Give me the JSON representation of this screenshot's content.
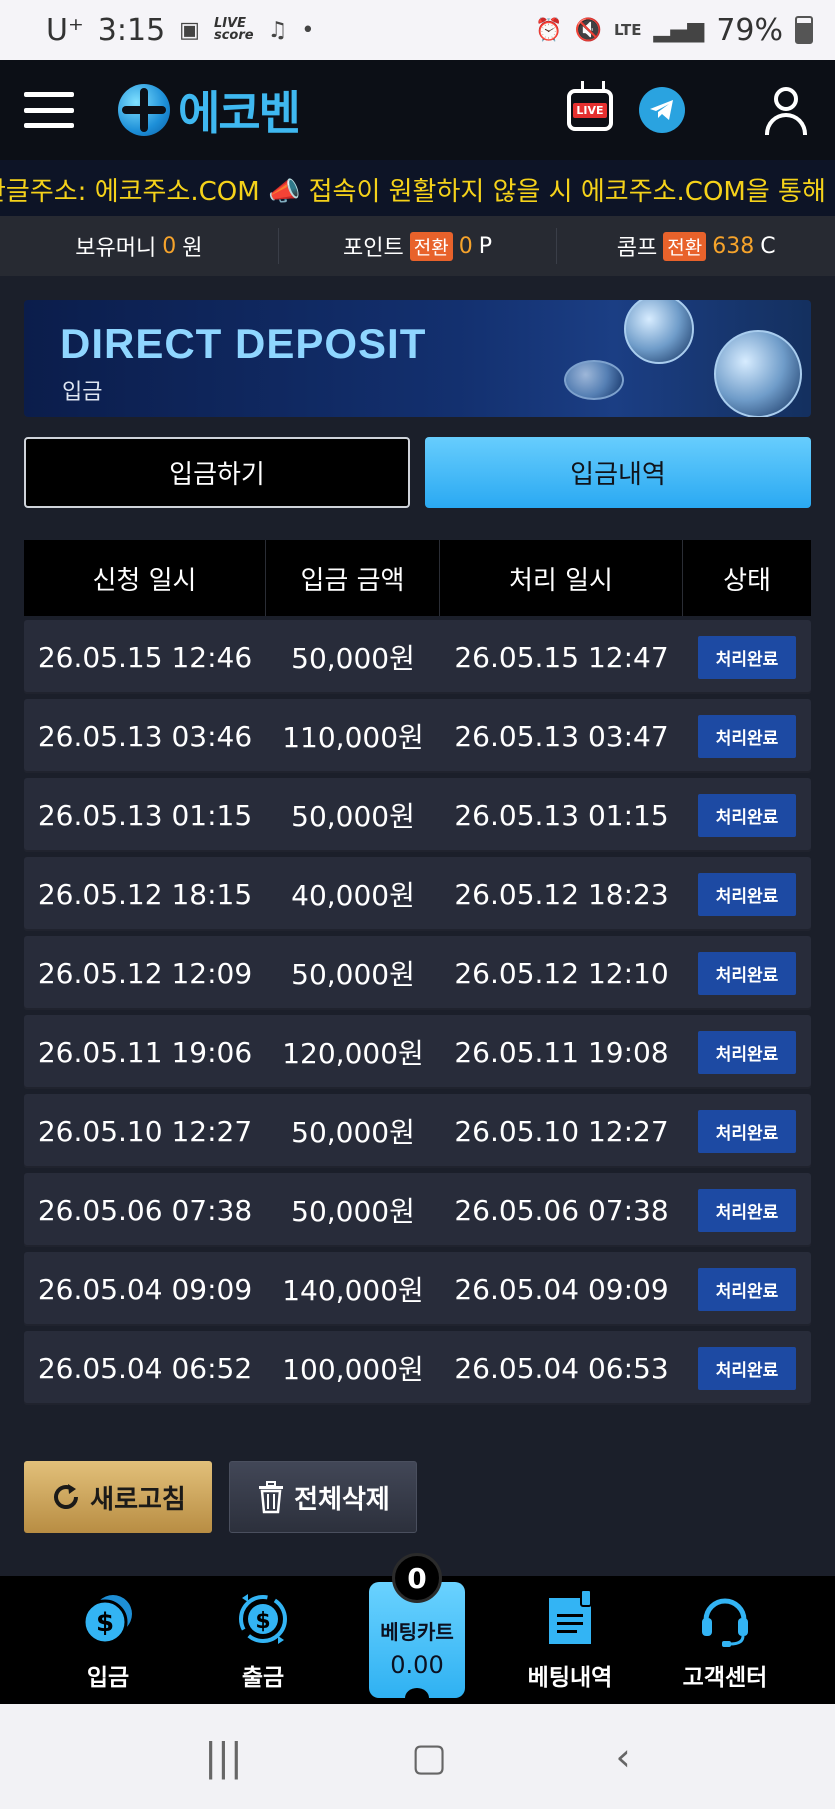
{
  "status_bar": {
    "carrier": "U⁺",
    "time": "3:15",
    "live_score": "LIVE\nscore",
    "battery": "79%",
    "network": "LTE"
  },
  "header": {
    "logo_text": "에코벤",
    "live_label": "LIVE"
  },
  "marquee": {
    "text": "한글주소: 에코주소.COM 📣 접속이 원활하지 않을 시 에코주소.COM을 통해"
  },
  "balance": {
    "money_label": "보유머니",
    "money_value": "0",
    "money_unit": "원",
    "point_label": "포인트",
    "point_convert": "전환",
    "point_value": "0",
    "point_unit": "P",
    "comp_label": "콤프",
    "comp_convert": "전환",
    "comp_value": "638",
    "comp_unit": "C"
  },
  "banner": {
    "title": "DIRECT DEPOSIT",
    "subtitle": "입금"
  },
  "tabs": {
    "deposit": "입금하기",
    "history": "입금내역"
  },
  "table": {
    "headers": [
      "신청 일시",
      "입금 금액",
      "처리 일시",
      "상태"
    ],
    "rows": [
      {
        "requested": "26.05.15 12:46",
        "amount": "50,000원",
        "processed": "26.05.15 12:47",
        "status": "처리완료"
      },
      {
        "requested": "26.05.13 03:46",
        "amount": "110,000원",
        "processed": "26.05.13 03:47",
        "status": "처리완료"
      },
      {
        "requested": "26.05.13 01:15",
        "amount": "50,000원",
        "processed": "26.05.13 01:15",
        "status": "처리완료"
      },
      {
        "requested": "26.05.12 18:15",
        "amount": "40,000원",
        "processed": "26.05.12 18:23",
        "status": "처리완료"
      },
      {
        "requested": "26.05.12 12:09",
        "amount": "50,000원",
        "processed": "26.05.12 12:10",
        "status": "처리완료"
      },
      {
        "requested": "26.05.11 19:06",
        "amount": "120,000원",
        "processed": "26.05.11 19:08",
        "status": "처리완료"
      },
      {
        "requested": "26.05.10 12:27",
        "amount": "50,000원",
        "processed": "26.05.10 12:27",
        "status": "처리완료"
      },
      {
        "requested": "26.05.06 07:38",
        "amount": "50,000원",
        "processed": "26.05.06 07:38",
        "status": "처리완료"
      },
      {
        "requested": "26.05.04 09:09",
        "amount": "140,000원",
        "processed": "26.05.04 09:09",
        "status": "처리완료"
      },
      {
        "requested": "26.05.04 06:52",
        "amount": "100,000원",
        "processed": "26.05.04 06:53",
        "status": "처리완료"
      }
    ]
  },
  "actions": {
    "refresh": "새로고침",
    "delete_all": "전체삭제"
  },
  "bottom_nav": {
    "deposit": "입금",
    "withdraw": "출금",
    "betcart_label": "베팅카트",
    "betcart_value": "0.00",
    "betcart_count": "0",
    "bet_history": "베팅내역",
    "support": "고객센터"
  },
  "colors": {
    "accent": "#2aa9f2",
    "highlight": "#f6a32b",
    "status_badge": "#1d4aa3",
    "marquee_text": "#f5d21a"
  }
}
